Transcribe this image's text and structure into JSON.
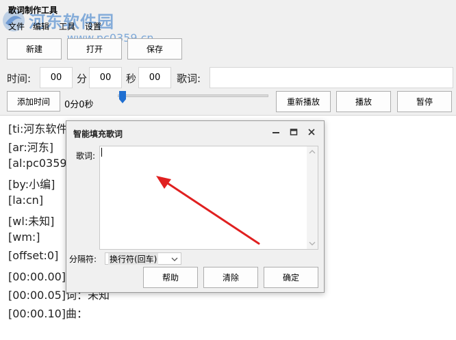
{
  "window": {
    "title": "歌词制作工具"
  },
  "menu": [
    "文件",
    "编辑",
    "工具",
    "设置"
  ],
  "watermark": {
    "brand": "河东软件园",
    "url": "www.pc0359.cn"
  },
  "toolbar": {
    "new_label": "新建",
    "open_label": "打开",
    "save_label": "保存"
  },
  "time_row": {
    "time_label": "时间:",
    "minutes": "00",
    "minutes_label": "分",
    "seconds": "00",
    "seconds_label": "秒",
    "hundredths": "00",
    "lyric_label": "歌词:",
    "lyric_value": ""
  },
  "playback": {
    "add_time_label": "添加时间",
    "position_text": "0分0秒",
    "progress": 0.02,
    "replay_label": "重新播放",
    "play_label": "播放",
    "pause_label": "暂停"
  },
  "lyrics": [
    "[ti:河东软件园]",
    "[ar:河东]",
    "[al:pc0359]",
    "[by:小编]",
    "[la:cn]",
    "[wl:未知]",
    "[wm:]",
    "[offset:0]",
    "[00:00.00]河",
    "[00:00.05]词：未知",
    "[00:00.10]曲："
  ],
  "dialog": {
    "title": "智能填充歌词",
    "lyric_label": "歌词:",
    "lyric_value": "",
    "separator_label": "分隔符:",
    "separator_value": "换行符(回车)",
    "help_label": "帮助",
    "clear_label": "清除",
    "ok_label": "确定"
  },
  "colors": {
    "accent": "#1f6fd1",
    "arrow": "#e02020",
    "watermark": "#6096d2"
  }
}
